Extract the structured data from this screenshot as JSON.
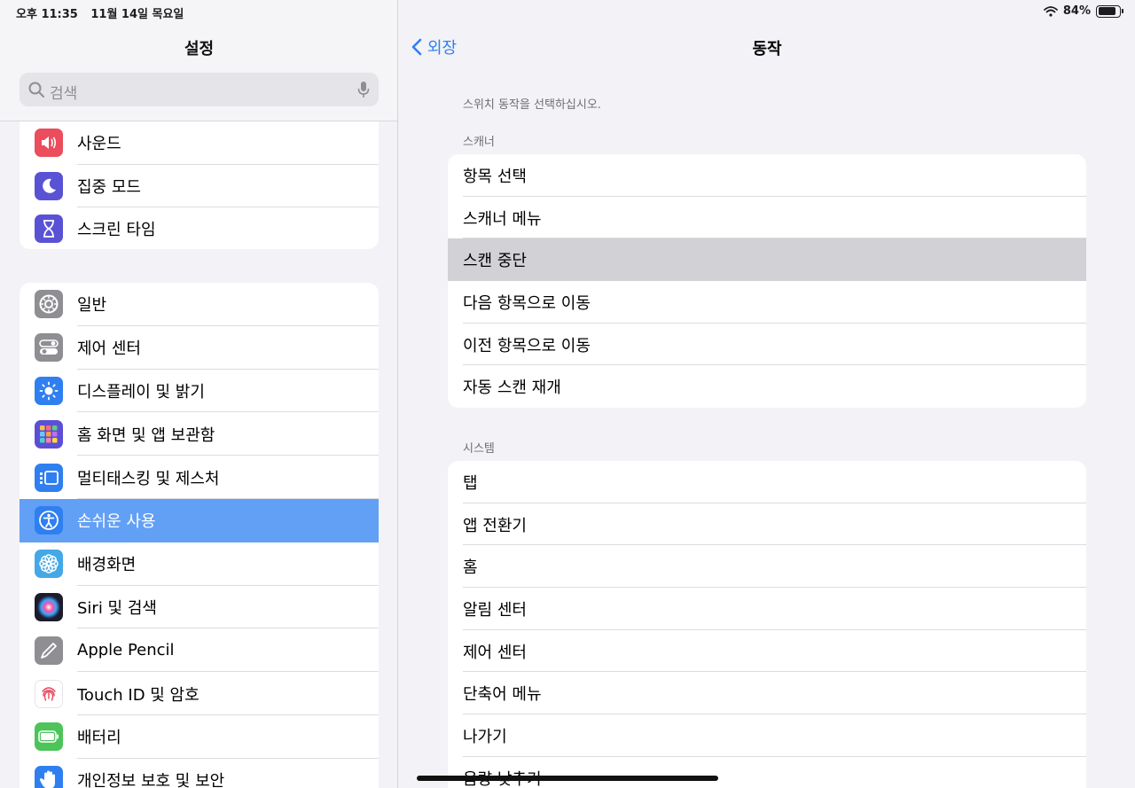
{
  "status": {
    "time": "오후 11:35",
    "date": "11월 14일 목요일",
    "battery_pct_label": "84%",
    "battery_level": 0.84
  },
  "sidebar": {
    "title": "설정",
    "search_placeholder": "검색",
    "group1": [
      {
        "label": "사운드",
        "icon": "speaker-icon",
        "color": "#eb4d5c"
      },
      {
        "label": "집중 모드",
        "icon": "moon-icon",
        "color": "#5a52d5"
      },
      {
        "label": "스크린 타임",
        "icon": "hourglass-icon",
        "color": "#5a52d5"
      }
    ],
    "group2": [
      {
        "label": "일반",
        "icon": "gear-icon",
        "color": "#8e8e93"
      },
      {
        "label": "제어 센터",
        "icon": "toggles-icon",
        "color": "#8e8e93"
      },
      {
        "label": "디스플레이 및 밝기",
        "icon": "sun-icon",
        "color": "#2f7ff0"
      },
      {
        "label": "홈 화면 및 앱 보관함",
        "icon": "app-grid-icon",
        "color": "#5b4fd6"
      },
      {
        "label": "멀티태스킹 및 제스처",
        "icon": "multitasking-icon",
        "color": "#2f7ff0"
      },
      {
        "label": "손쉬운 사용",
        "icon": "accessibility-icon",
        "color": "#2f7ff0",
        "selected": true
      },
      {
        "label": "배경화면",
        "icon": "flower-icon",
        "color": "#45a8e6"
      },
      {
        "label": "Siri 및 검색",
        "icon": "siri-icon",
        "color": "#1c1c2e"
      },
      {
        "label": "Apple Pencil",
        "icon": "pencil-icon",
        "color": "#8e8e93"
      },
      {
        "label": "Touch ID 및 암호",
        "icon": "fingerprint-icon",
        "color": "#ffffff"
      },
      {
        "label": "배터리",
        "icon": "battery-icon",
        "color": "#4cc45a"
      },
      {
        "label": "개인정보 보호 및 보안",
        "icon": "hand-icon",
        "color": "#2f7ff0"
      }
    ]
  },
  "detail": {
    "back_label": "외장",
    "title": "동작",
    "hint": "스위치 동작을 선택하십시오.",
    "scanner_header": "스캐너",
    "scanner_items": [
      "항목 선택",
      "스캐너 메뉴",
      "스캔 중단",
      "다음 항목으로 이동",
      "이전 항목으로 이동",
      "자동 스캔 재개"
    ],
    "highlighted_index": 2,
    "system_header": "시스템",
    "system_items": [
      "탭",
      "앱 전환기",
      "홈",
      "알림 센터",
      "제어 센터",
      "단축어 메뉴",
      "나가기",
      "음량 낮추기"
    ]
  }
}
